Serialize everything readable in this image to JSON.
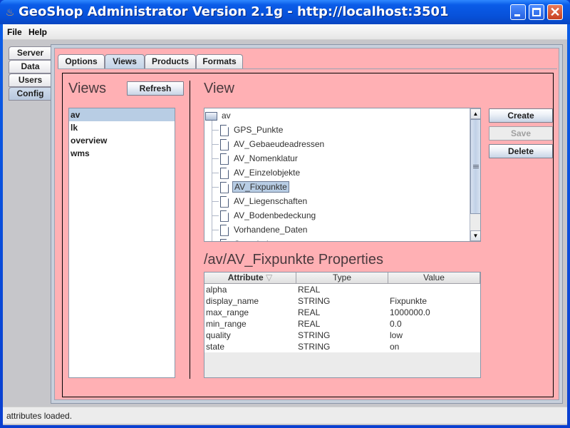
{
  "window": {
    "title": "GeoShop Administrator Version 2.1g - http://localhost:3501",
    "controls": {
      "minimize": "minimize",
      "maximize": "maximize",
      "close": "✕"
    }
  },
  "menu": {
    "items": [
      "File",
      "Help"
    ]
  },
  "side_tabs": [
    {
      "label": "Server",
      "active": false
    },
    {
      "label": "Data",
      "active": false
    },
    {
      "label": "Users",
      "active": false
    },
    {
      "label": "Config",
      "active": true
    }
  ],
  "top_tabs": [
    {
      "label": "Options",
      "active": false
    },
    {
      "label": "Views",
      "active": true
    },
    {
      "label": "Products",
      "active": false
    },
    {
      "label": "Formats",
      "active": false
    }
  ],
  "views_panel": {
    "title": "Views",
    "refresh_label": "Refresh",
    "items": [
      {
        "label": "av",
        "selected": true
      },
      {
        "label": "lk",
        "selected": false
      },
      {
        "label": "overview",
        "selected": false
      },
      {
        "label": "wms",
        "selected": false
      }
    ]
  },
  "view_panel": {
    "title": "View",
    "tree": {
      "root": "av",
      "children": [
        {
          "label": "GPS_Punkte",
          "selected": false
        },
        {
          "label": "AV_Gebaeudeadressen",
          "selected": false
        },
        {
          "label": "AV_Nomenklatur",
          "selected": false
        },
        {
          "label": "AV_Einzelobjekte",
          "selected": false
        },
        {
          "label": "AV_Fixpunkte",
          "selected": true
        },
        {
          "label": "AV_Liegenschaften",
          "selected": false
        },
        {
          "label": "AV_Bodenbedeckung",
          "selected": false
        },
        {
          "label": "Vorhandene_Daten",
          "selected": false
        },
        {
          "label": "Gemeindegrenzen",
          "selected": false
        }
      ]
    },
    "buttons": {
      "create": "Create",
      "save": "Save",
      "delete": "Delete"
    },
    "scroll_up": "▲",
    "scroll_down": "▼"
  },
  "properties": {
    "title": "/av/AV_Fixpunkte Properties",
    "columns": [
      "Attribute",
      "Type",
      "Value"
    ],
    "sort_indicator": "▽",
    "rows": [
      {
        "attribute": "alpha",
        "type": "REAL",
        "value": ""
      },
      {
        "attribute": "display_name",
        "type": "STRING",
        "value": "Fixpunkte"
      },
      {
        "attribute": "max_range",
        "type": "REAL",
        "value": "1000000.0"
      },
      {
        "attribute": "min_range",
        "type": "REAL",
        "value": "0.0"
      },
      {
        "attribute": "quality",
        "type": "STRING",
        "value": "low"
      },
      {
        "attribute": "state",
        "type": "STRING",
        "value": "on"
      }
    ]
  },
  "status": {
    "text": "attributes loaded."
  }
}
